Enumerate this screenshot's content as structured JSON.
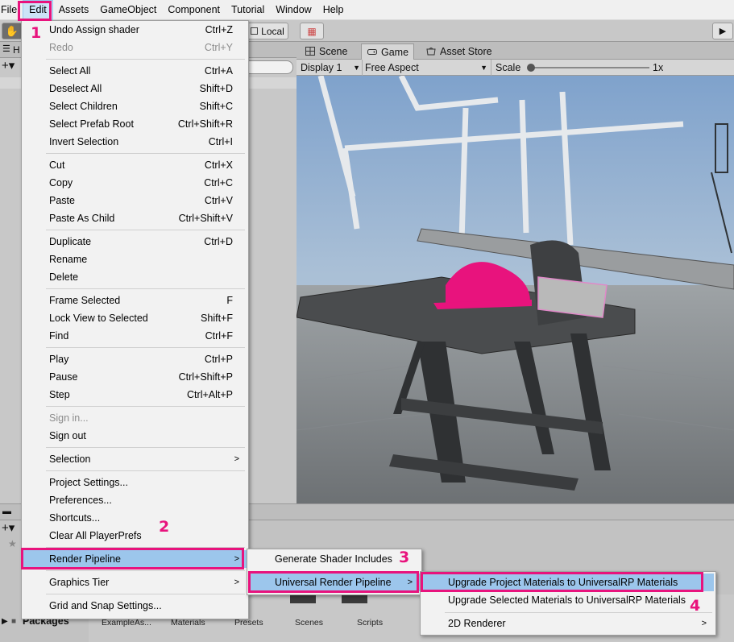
{
  "menubar": [
    "File",
    "Edit",
    "Assets",
    "GameObject",
    "Component",
    "Tutorial",
    "Window",
    "Help"
  ],
  "toolbar": {
    "pivot_label": "Local"
  },
  "left_panel": {
    "tab_label": "H"
  },
  "view_tabs": [
    "Scene",
    "Game",
    "Asset Store"
  ],
  "view_controls": {
    "display": "Display 1",
    "aspect": "Free Aspect",
    "scale_label": "Scale",
    "scale_value": "1x"
  },
  "edit_menu": [
    {
      "label": "Undo Assign shader",
      "shortcut": "Ctrl+Z"
    },
    {
      "label": "Redo",
      "shortcut": "Ctrl+Y",
      "disabled": true
    },
    {
      "label": "Select All",
      "shortcut": "Ctrl+A"
    },
    {
      "label": "Deselect All",
      "shortcut": "Shift+D"
    },
    {
      "label": "Select Children",
      "shortcut": "Shift+C"
    },
    {
      "label": "Select Prefab Root",
      "shortcut": "Ctrl+Shift+R"
    },
    {
      "label": "Invert Selection",
      "shortcut": "Ctrl+I"
    },
    {
      "label": "Cut",
      "shortcut": "Ctrl+X"
    },
    {
      "label": "Copy",
      "shortcut": "Ctrl+C"
    },
    {
      "label": "Paste",
      "shortcut": "Ctrl+V"
    },
    {
      "label": "Paste As Child",
      "shortcut": "Ctrl+Shift+V"
    },
    {
      "label": "Duplicate",
      "shortcut": "Ctrl+D"
    },
    {
      "label": "Rename",
      "shortcut": ""
    },
    {
      "label": "Delete",
      "shortcut": ""
    },
    {
      "label": "Frame Selected",
      "shortcut": "F"
    },
    {
      "label": "Lock View to Selected",
      "shortcut": "Shift+F"
    },
    {
      "label": "Find",
      "shortcut": "Ctrl+F"
    },
    {
      "label": "Play",
      "shortcut": "Ctrl+P"
    },
    {
      "label": "Pause",
      "shortcut": "Ctrl+Shift+P"
    },
    {
      "label": "Step",
      "shortcut": "Ctrl+Alt+P"
    },
    {
      "label": "Sign in...",
      "shortcut": "",
      "disabled": true
    },
    {
      "label": "Sign out",
      "shortcut": ""
    },
    {
      "label": "Selection",
      "shortcut": ""
    },
    {
      "label": "Project Settings...",
      "shortcut": ""
    },
    {
      "label": "Preferences...",
      "shortcut": ""
    },
    {
      "label": "Shortcuts...",
      "shortcut": ""
    },
    {
      "label": "Clear All PlayerPrefs",
      "shortcut": ""
    },
    {
      "label": "Render Pipeline",
      "shortcut": ""
    },
    {
      "label": "Graphics Tier",
      "shortcut": ""
    },
    {
      "label": "Grid and Snap Settings...",
      "shortcut": ""
    }
  ],
  "render_pipeline_menu": [
    "Generate Shader Includes",
    "Universal Render Pipeline"
  ],
  "urp_menu": [
    "Upgrade Project Materials to UniversalRP Materials",
    "Upgrade Selected Materials to UniversalRP Materials",
    "2D Renderer"
  ],
  "bottom_panel": {
    "folder_label": "Packages",
    "assets": [
      "ExampleAs...",
      "Materials",
      "Presets",
      "Scenes",
      "Scripts"
    ]
  },
  "annotations": [
    "1",
    "2",
    "3",
    "4"
  ],
  "colors": {
    "annotation": "#e8137d",
    "highlight": "#9cc6ec"
  }
}
